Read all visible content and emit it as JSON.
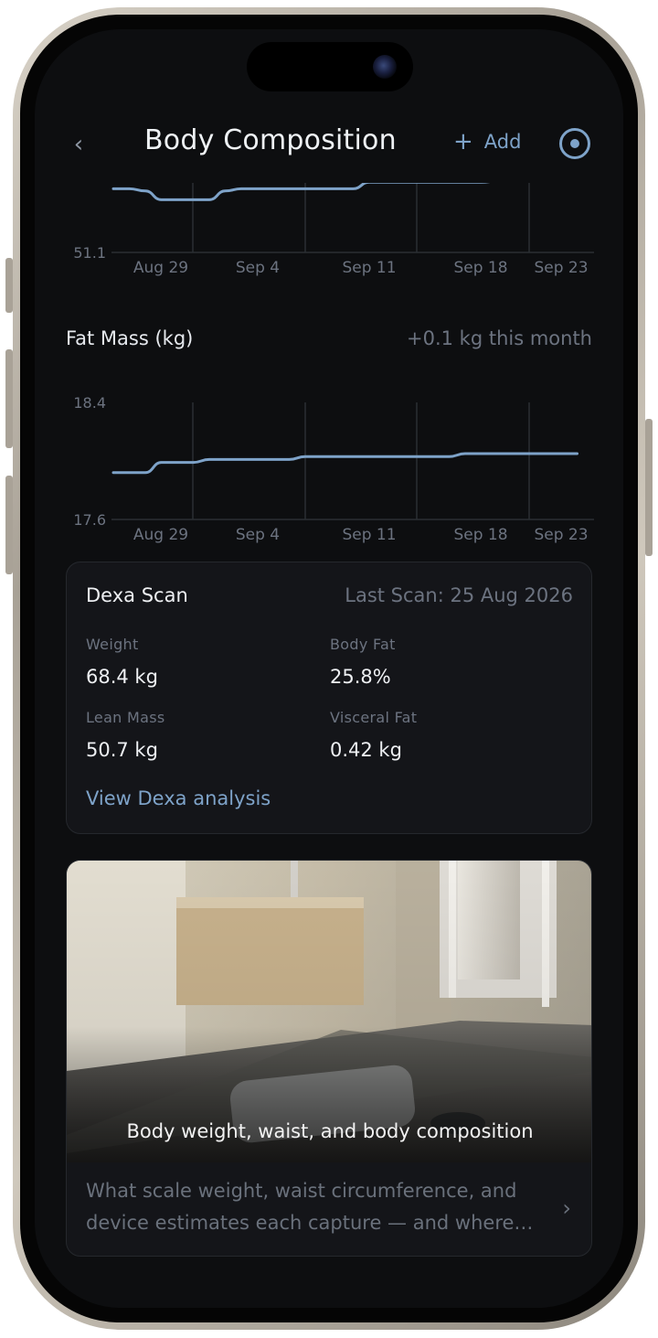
{
  "header": {
    "title": "Body Composition",
    "add_label": "Add",
    "back_icon": "chevron-left-icon",
    "target_icon": "target-icon"
  },
  "colors": {
    "background": "#0d0e10",
    "accent": "#7ea3c9",
    "card": "#141519",
    "muted_text": "#6c7380"
  },
  "chart_data": [
    {
      "type": "line",
      "title": "",
      "ylabel": "",
      "ylim_bottom_label": "51.1",
      "x_tick_labels": [
        "Aug 29",
        "Sep 4",
        "Sep 11",
        "Sep 18",
        "Sep 23"
      ],
      "x": [
        "Aug 26",
        "Aug 27",
        "Aug 28",
        "Aug 29",
        "Aug 30",
        "Aug 31",
        "Sep 1",
        "Sep 2",
        "Sep 3",
        "Sep 4",
        "Sep 5",
        "Sep 6",
        "Sep 7",
        "Sep 8",
        "Sep 9",
        "Sep 10",
        "Sep 11",
        "Sep 12",
        "Sep 13",
        "Sep 14",
        "Sep 15",
        "Sep 16",
        "Sep 17",
        "Sep 18",
        "Sep 19"
      ],
      "series": [
        {
          "values": [
            51.68,
            51.68,
            51.66,
            51.58,
            51.58,
            51.58,
            51.58,
            51.66,
            51.68,
            51.68,
            51.68,
            51.68,
            51.68,
            51.68,
            51.68,
            51.68,
            51.74,
            51.74,
            51.74,
            51.74,
            51.74,
            51.74,
            51.74,
            51.74,
            51.75
          ]
        }
      ],
      "ylim": [
        51.1,
        51.75
      ],
      "partial": true,
      "grid": "vertical"
    },
    {
      "type": "line",
      "title": "Fat Mass (kg)",
      "delta": "+0.1 kg this month",
      "y_tick_labels": [
        "18.4",
        "17.6"
      ],
      "x_tick_labels": [
        "Aug 29",
        "Sep 4",
        "Sep 11",
        "Sep 18",
        "Sep 23"
      ],
      "x": [
        "Aug 26",
        "Aug 27",
        "Aug 28",
        "Aug 29",
        "Aug 30",
        "Aug 31",
        "Sep 1",
        "Sep 2",
        "Sep 3",
        "Sep 4",
        "Sep 5",
        "Sep 6",
        "Sep 7",
        "Sep 8",
        "Sep 9",
        "Sep 10",
        "Sep 11",
        "Sep 12",
        "Sep 13",
        "Sep 14",
        "Sep 15",
        "Sep 16",
        "Sep 17",
        "Sep 18",
        "Sep 19",
        "Sep 20",
        "Sep 21",
        "Sep 22",
        "Sep 23",
        "Sep 24"
      ],
      "series": [
        {
          "values": [
            17.92,
            17.92,
            17.92,
            17.99,
            17.99,
            17.99,
            18.01,
            18.01,
            18.01,
            18.01,
            18.01,
            18.01,
            18.03,
            18.03,
            18.03,
            18.03,
            18.03,
            18.03,
            18.03,
            18.03,
            18.03,
            18.03,
            18.05,
            18.05,
            18.05,
            18.05,
            18.05,
            18.05,
            18.05,
            18.05
          ]
        }
      ],
      "ylim": [
        17.6,
        18.4
      ],
      "grid": "vertical"
    }
  ],
  "dexa": {
    "title": "Dexa Scan",
    "last_scan": "Last Scan: 25 Aug 2026",
    "metrics": [
      {
        "label": "Weight",
        "value": "68.4 kg"
      },
      {
        "label": "Body Fat",
        "value": "25.8%"
      },
      {
        "label": "Lean Mass",
        "value": "50.7 kg"
      },
      {
        "label": "Visceral Fat",
        "value": "0.42 kg"
      }
    ],
    "link": "View Dexa analysis"
  },
  "article": {
    "caption": "Body weight, waist, and body composition",
    "description": "What scale weight, waist circumference, and device estimates each capture — and where…",
    "chevron_icon": "chevron-right-icon"
  }
}
